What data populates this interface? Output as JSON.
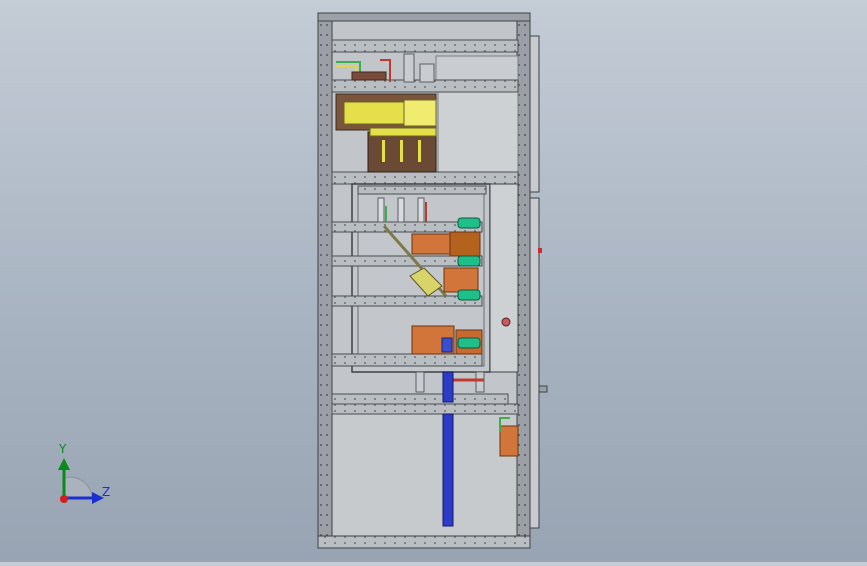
{
  "triad": {
    "y_label": "Y",
    "z_label": "Z"
  },
  "colors": {
    "frame": "#8a9096",
    "rail": "#b7bcc1",
    "busbar_yellow": "#e5e04a",
    "busbar_brown": "#6a4a35",
    "copper": "#d2753a",
    "green_terminal": "#1fbf8a",
    "blue_bar": "#2c3cc8",
    "axis_y": "#0a8a1a",
    "axis_z": "#1b2fd0",
    "origin": "#d61c1c"
  }
}
